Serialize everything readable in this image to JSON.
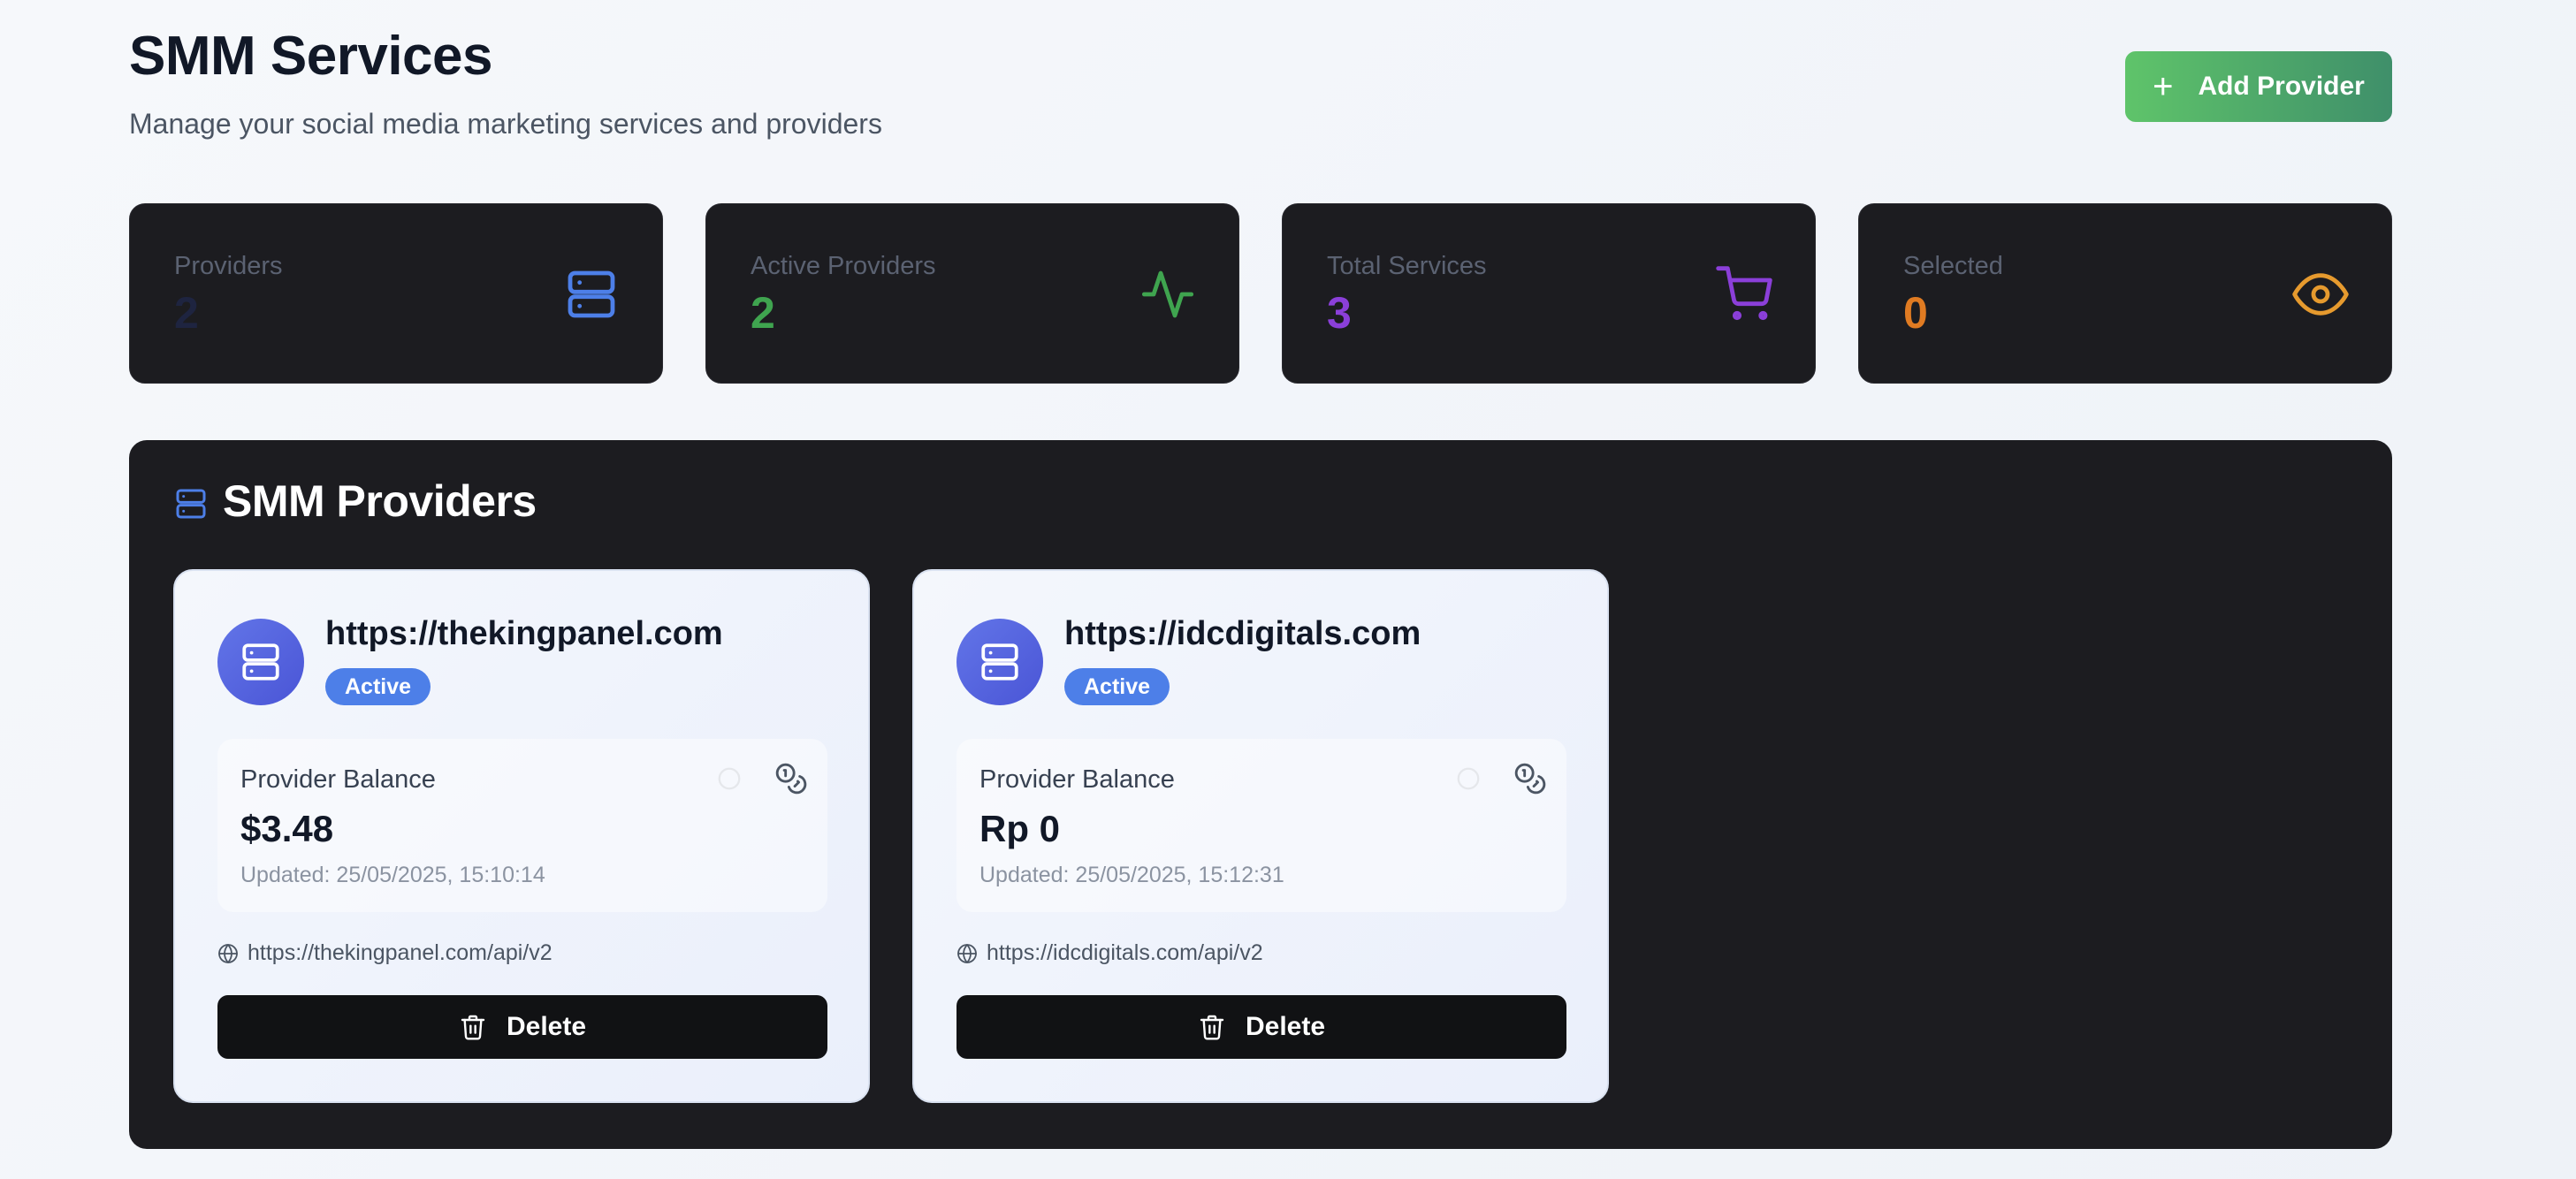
{
  "header": {
    "title": "SMM Services",
    "subtitle": "Manage your social media marketing services and providers",
    "add_button_label": "Add Provider"
  },
  "stats": [
    {
      "label": "Providers",
      "value": "2",
      "color": "#1e2440",
      "icon": "server-icon"
    },
    {
      "label": "Active Providers",
      "value": "2",
      "color": "#3fa44f",
      "icon": "activity-icon"
    },
    {
      "label": "Total Services",
      "value": "3",
      "color": "#8b3fd9",
      "icon": "cart-icon"
    },
    {
      "label": "Selected",
      "value": "0",
      "color": "#e07b22",
      "icon": "eye-icon"
    }
  ],
  "panel": {
    "title": "SMM Providers"
  },
  "providers": [
    {
      "name": "https://thekingpanel.com",
      "status": "Active",
      "balance_label": "Provider Balance",
      "balance": "$3.48",
      "updated": "Updated: 25/05/2025, 15:10:14",
      "api_url": "https://thekingpanel.com/api/v2",
      "delete_label": "Delete"
    },
    {
      "name": "https://idcdigitals.com",
      "status": "Active",
      "balance_label": "Provider Balance",
      "balance": "Rp 0",
      "updated": "Updated: 25/05/2025, 15:12:31",
      "api_url": "https://idcdigitals.com/api/v2",
      "delete_label": "Delete"
    }
  ],
  "colors": {
    "add_button_start": "#5fc46a",
    "add_button_end": "#3f8f6a",
    "panel_bg": "#1c1c20",
    "badge": "#4d7fe8",
    "server_icon": "#4d7fe8"
  }
}
